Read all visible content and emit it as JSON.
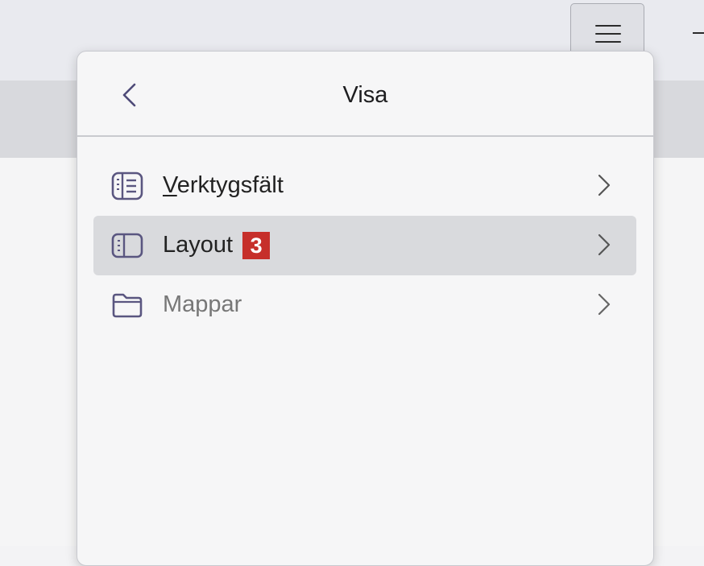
{
  "panel": {
    "title": "Visa",
    "back_icon": "chevron-left-icon"
  },
  "menu": {
    "items": [
      {
        "label_access": "V",
        "label_rest": "erktygsfält",
        "icon": "toolbar-list-icon",
        "selected": false,
        "disabled": false
      },
      {
        "label": "Layout",
        "badge": "3",
        "icon": "layout-panel-icon",
        "selected": true,
        "disabled": false
      },
      {
        "label": "Mappar",
        "icon": "folder-icon",
        "selected": false,
        "disabled": true
      }
    ]
  },
  "colors": {
    "badge": "#c62f2a",
    "icon": "#5a5680",
    "selected_bg": "#d9dadd"
  }
}
